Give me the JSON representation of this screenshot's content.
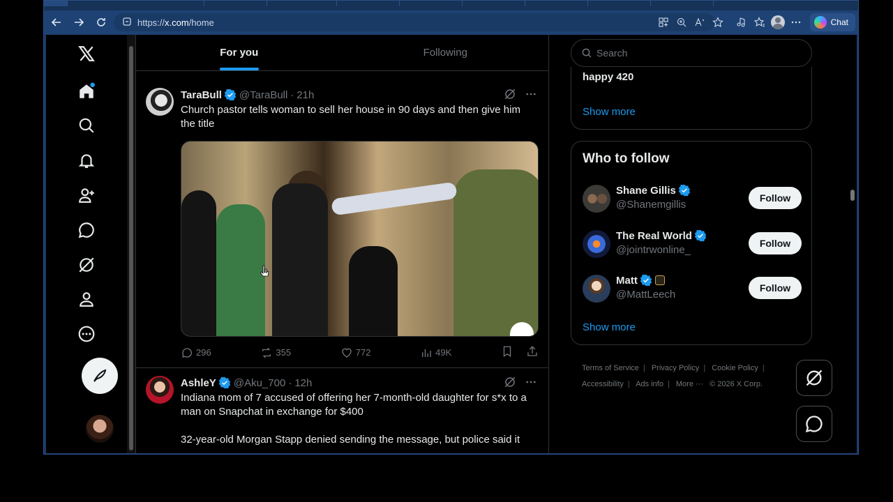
{
  "browser": {
    "url_prefix": "https://",
    "url_domain": "x.com",
    "url_path": "/home",
    "copilot_label": "Chat"
  },
  "feed": {
    "tabs": [
      {
        "label": "For you",
        "active": true
      },
      {
        "label": "Following",
        "active": false
      }
    ],
    "tweets": [
      {
        "name": "TaraBull",
        "handle": "@TaraBull",
        "time": "21h",
        "text": "Church pastor tells woman to sell her house in 90 days and then give him the title",
        "replies": "296",
        "reposts": "355",
        "likes": "772",
        "views": "49K"
      },
      {
        "name": "AshleY",
        "handle": "@Aku_700",
        "time": "12h",
        "text": "Indiana mom of 7 accused of offering her 7-month-old daughter for s*x to a man on Snapchat in exchange for $400\n\n32-year-old Morgan Stapp denied sending the message, but police said it"
      }
    ],
    "separator": "·"
  },
  "sidebar": {
    "search_placeholder": "Search",
    "trend_title": "happy 420",
    "trend_show_more": "Show more",
    "who_to_follow_title": "Who to follow",
    "people": [
      {
        "name": "Shane Gillis",
        "handle": "@Shanemgillis",
        "button": "Follow"
      },
      {
        "name": "The Real World",
        "handle": "@jointrwonline_",
        "button": "Follow"
      },
      {
        "name": "Matt",
        "handle": "@MattLeech",
        "button": "Follow"
      }
    ],
    "wtf_show_more": "Show more",
    "footer_links": [
      "Terms of Service",
      "Privacy Policy",
      "Cookie Policy",
      "Accessibility",
      "Ads info",
      "More ···",
      "© 2026 X Corp."
    ]
  },
  "colors": {
    "accent": "#1d9bf0",
    "background": "#000000",
    "border": "#2f3336",
    "text_primary": "#e7e9ea",
    "text_secondary": "#71767b",
    "browser_chrome": "#1e4273"
  }
}
